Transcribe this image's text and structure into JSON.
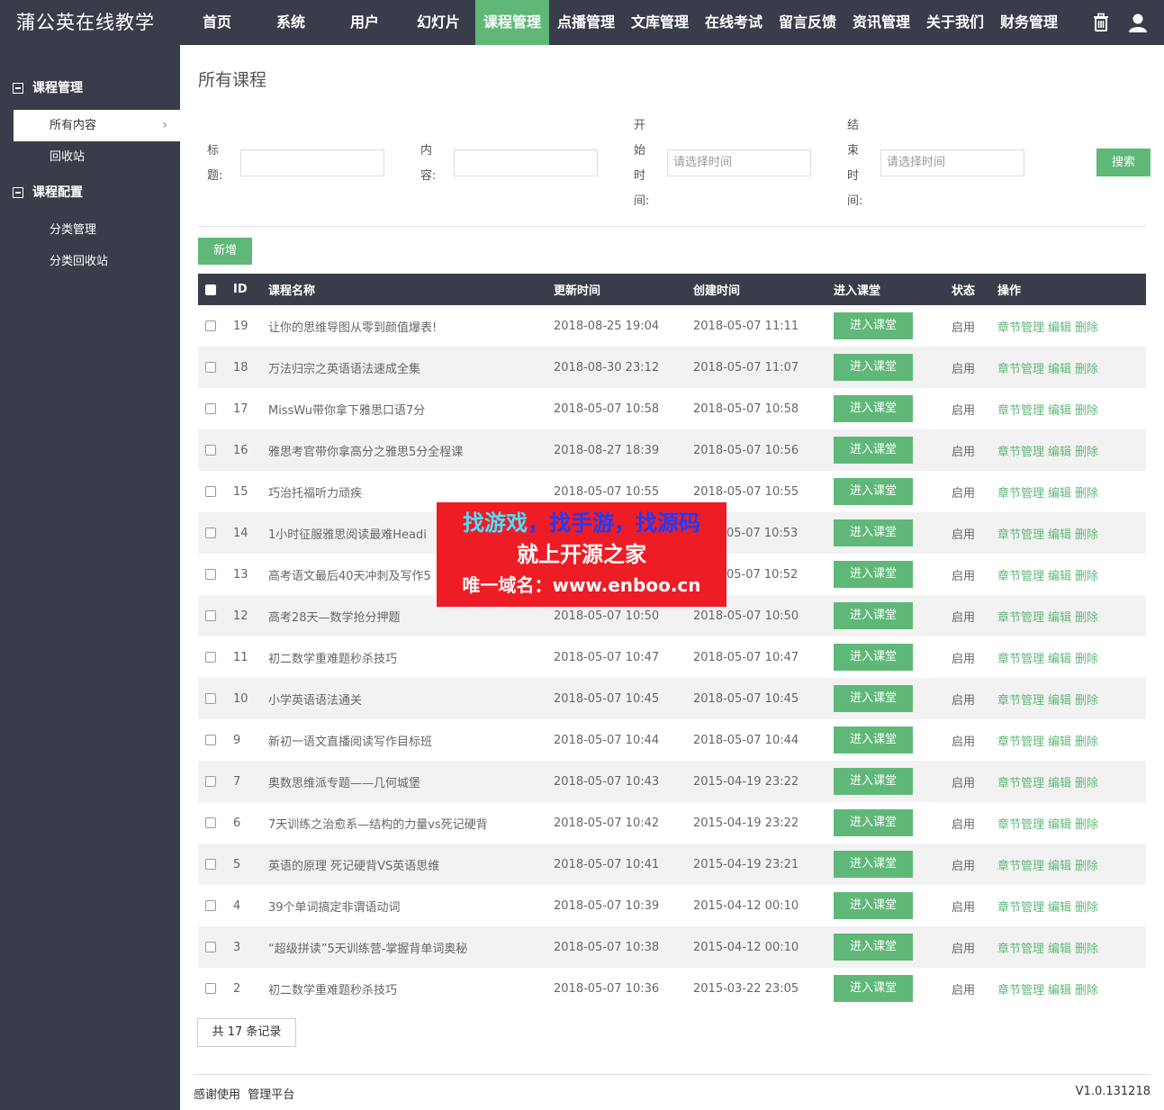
{
  "app": {
    "brand": "蒲公英在线教学"
  },
  "nav": [
    {
      "label": "首页"
    },
    {
      "label": "系统"
    },
    {
      "label": "用户"
    },
    {
      "label": "幻灯片"
    },
    {
      "label": "课程管理",
      "active": true
    },
    {
      "label": "点播管理"
    },
    {
      "label": "文库管理"
    },
    {
      "label": "在线考试"
    },
    {
      "label": "留言反馈"
    },
    {
      "label": "资讯管理"
    },
    {
      "label": "关于我们"
    },
    {
      "label": "财务管理"
    }
  ],
  "top_icons": [
    "trash-icon",
    "user-icon"
  ],
  "sidebar": {
    "groups": [
      {
        "label": "课程管理",
        "items": [
          {
            "label": "所有内容",
            "active": true
          },
          {
            "label": "回收站"
          }
        ]
      },
      {
        "label": "课程配置",
        "items": [
          {
            "label": "分类管理"
          },
          {
            "label": "分类回收站"
          }
        ]
      }
    ]
  },
  "page": {
    "title": "所有课程"
  },
  "filters": {
    "title_label": "标题:",
    "content_label": "内容:",
    "start_label": "开始时间:",
    "end_label": "结束时间:",
    "title_value": "",
    "content_value": "",
    "start_placeholder": "请选择时间",
    "end_placeholder": "请选择时间",
    "search_label": "搜索"
  },
  "toolbar": {
    "add_label": "新增"
  },
  "table": {
    "headers": {
      "id": "ID",
      "name": "课程名称",
      "updated": "更新时间",
      "created": "创建时间",
      "enter": "进入课堂",
      "status": "状态",
      "ops": "操作"
    },
    "enter_label": "进入课堂",
    "ops_labels": {
      "chapters": "章节管理",
      "edit": "编辑",
      "delete": "删除"
    },
    "rows": [
      {
        "id": "19",
        "name": "让你的思维导图从零到颜值爆表!",
        "updated": "2018-08-25 19:04",
        "created": "2018-05-07 11:11",
        "status": "启用"
      },
      {
        "id": "18",
        "name": "万法归宗之英语语法速成全集",
        "updated": "2018-08-30 23:12",
        "created": "2018-05-07 11:07",
        "status": "启用"
      },
      {
        "id": "17",
        "name": "MissWu带你拿下雅思口语7分",
        "updated": "2018-05-07 10:58",
        "created": "2018-05-07 10:58",
        "status": "启用"
      },
      {
        "id": "16",
        "name": "雅思考官带你拿高分之雅思5分全程课",
        "updated": "2018-08-27 18:39",
        "created": "2018-05-07 10:56",
        "status": "启用"
      },
      {
        "id": "15",
        "name": "巧治托福听力顽疾",
        "updated": "2018-05-07 10:55",
        "created": "2018-05-07 10:55",
        "status": "启用"
      },
      {
        "id": "14",
        "name": "1小时征服雅思阅读最难Headi",
        "updated": "",
        "created": "3-05-07 10:53",
        "status": "启用"
      },
      {
        "id": "13",
        "name": "高考语文最后40天冲刺及写作5",
        "updated": "",
        "created": "3-05-07 10:52",
        "status": "启用"
      },
      {
        "id": "12",
        "name": "高考28天—数学抢分押题",
        "updated": "2018-05-07 10:50",
        "created": "2018-05-07 10:50",
        "status": "启用"
      },
      {
        "id": "11",
        "name": "初二数学重难题秒杀技巧",
        "updated": "2018-05-07 10:47",
        "created": "2018-05-07 10:47",
        "status": "启用"
      },
      {
        "id": "10",
        "name": "小学英语语法通关",
        "updated": "2018-05-07 10:45",
        "created": "2018-05-07 10:45",
        "status": "启用"
      },
      {
        "id": "9",
        "name": "新初一语文直播阅读写作目标班",
        "updated": "2018-05-07 10:44",
        "created": "2018-05-07 10:44",
        "status": "启用"
      },
      {
        "id": "7",
        "name": "奥数思维派专题——几何城堡",
        "updated": "2018-05-07 10:43",
        "created": "2015-04-19 23:22",
        "status": "启用"
      },
      {
        "id": "6",
        "name": "7天训练之治愈系—结构的力量vs死记硬背",
        "updated": "2018-05-07 10:42",
        "created": "2015-04-19 23:22",
        "status": "启用"
      },
      {
        "id": "5",
        "name": "英语的原理 死记硬背VS英语思维",
        "updated": "2018-05-07 10:41",
        "created": "2015-04-19 23:21",
        "status": "启用"
      },
      {
        "id": "4",
        "name": "39个单词搞定非谓语动词",
        "updated": "2018-05-07 10:39",
        "created": "2015-04-12 00:10",
        "status": "启用"
      },
      {
        "id": "3",
        "name": "“超级拼读”5天训练营-掌握背单词奥秘",
        "updated": "2018-05-07 10:38",
        "created": "2015-04-12 00:10",
        "status": "启用"
      },
      {
        "id": "2",
        "name": "初二数学重难题秒杀技巧",
        "updated": "2018-05-07 10:36",
        "created": "2015-03-22 23:05",
        "status": "启用"
      }
    ]
  },
  "pager": {
    "total_text": "共 17 条记录"
  },
  "footer": {
    "left": "感谢使用  管理平台",
    "version": "V1.0.131218"
  },
  "banner": {
    "line1_a": "找游戏",
    "line1_b": "，找手游，找源码",
    "line2": "就上开源之家",
    "line3": "唯一域名：www.enboo.cn"
  },
  "colors": {
    "dark": "#393d49",
    "accent": "#5fb878",
    "banner": "#ee1c24"
  }
}
